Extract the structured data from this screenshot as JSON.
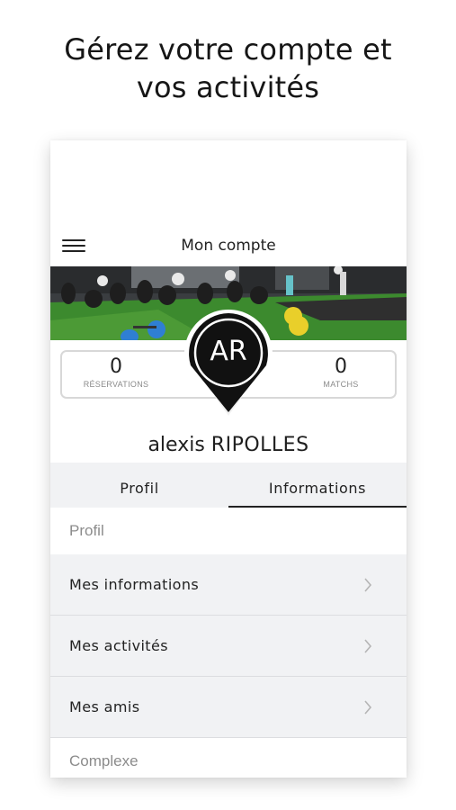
{
  "headline": {
    "line1": "Gérez votre compte et",
    "line2": "vos activités"
  },
  "header": {
    "title": "Mon compte",
    "menu_icon": "hamburger-menu-icon"
  },
  "stats": {
    "reservations": {
      "value": "0",
      "label": "RÉSERVATIONS"
    },
    "matchs": {
      "value": "0",
      "label": "MATCHS"
    }
  },
  "avatar": {
    "initials": "AR"
  },
  "user": {
    "first_name": "alexis",
    "last_name": "RIPOLLES"
  },
  "tabs": [
    {
      "label": "Profil",
      "active": false
    },
    {
      "label": "Informations",
      "active": true
    }
  ],
  "sections": {
    "profil": {
      "title": "Profil",
      "items": [
        {
          "label": "Mes informations"
        },
        {
          "label": "Mes activités"
        },
        {
          "label": "Mes amis"
        }
      ]
    },
    "complexe": {
      "title": "Complexe"
    }
  },
  "colors": {
    "text": "#222222",
    "muted": "#8c8c8c",
    "row_bg": "#f1f2f4",
    "pin": "#111111"
  }
}
